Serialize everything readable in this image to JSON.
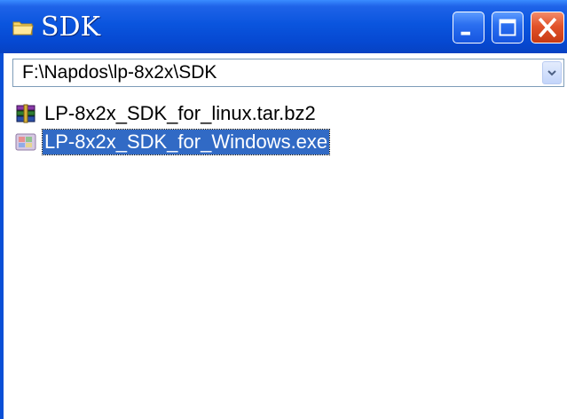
{
  "window": {
    "title": "SDK",
    "title_icon": "folder-icon",
    "colors": {
      "titlebar": "#0a55de",
      "close": "#e2532b",
      "selection": "#316ac5"
    }
  },
  "controls": {
    "minimize_icon": "minimize-icon",
    "maximize_icon": "maximize-icon",
    "close_icon": "close-icon"
  },
  "address_bar": {
    "path": "F:\\Napdos\\lp-8x2x\\SDK",
    "dropdown_icon": "chevron-down-icon"
  },
  "files": [
    {
      "name": "LP-8x2x_SDK_for_linux.tar.bz2",
      "icon": "archive-icon",
      "selected": false
    },
    {
      "name": "LP-8x2x_SDK_for_Windows.exe",
      "icon": "installer-icon",
      "selected": true
    }
  ]
}
